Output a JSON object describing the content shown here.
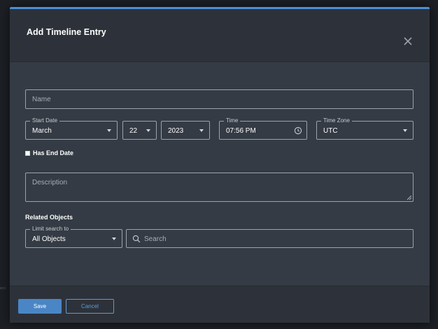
{
  "modal": {
    "title": "Add Timeline Entry",
    "close_icon": "close-icon"
  },
  "form": {
    "name": {
      "placeholder": "Name",
      "value": ""
    },
    "start_date": {
      "label": "Start Date",
      "month": "March",
      "day": "22",
      "year": "2023"
    },
    "time": {
      "label": "Time",
      "value": "07:56 PM",
      "icon": "clock-icon"
    },
    "time_zone": {
      "label": "Time Zone",
      "value": "UTC"
    },
    "has_end_date": {
      "label": "Has End Date",
      "checked": false
    },
    "description": {
      "placeholder": "Description",
      "value": ""
    },
    "related_objects": {
      "heading": "Related Objects",
      "limit": {
        "label": "Limit search to",
        "value": "All Objects"
      },
      "search": {
        "placeholder": "Search",
        "icon": "search-icon"
      }
    }
  },
  "footer": {
    "save_label": "Save",
    "cancel_label": "Cancel"
  },
  "colors": {
    "accent": "#4a8fd6",
    "modal_bg": "#343b44",
    "header_bg": "#2d323a",
    "save_bg": "#4a86c5"
  }
}
